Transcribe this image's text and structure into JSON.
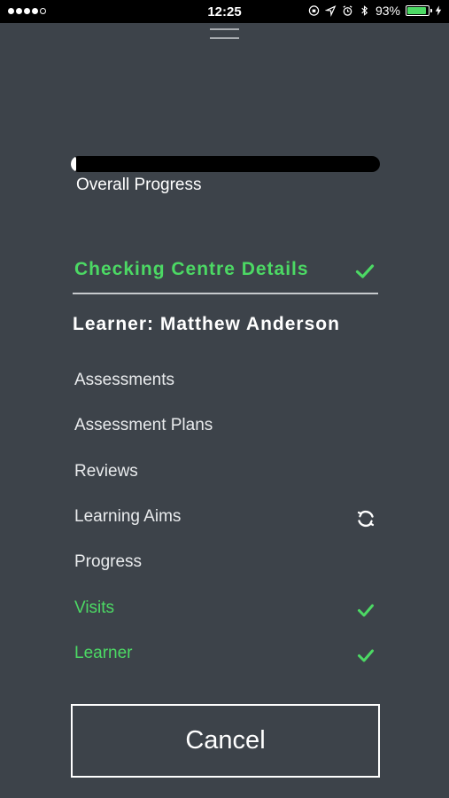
{
  "status_bar": {
    "time": "12:25",
    "battery_percent": "93%",
    "battery_level": 0.93,
    "signal_bars_filled": 4,
    "signal_bars_total": 5
  },
  "progress": {
    "label": "Overall Progress",
    "value": 0.01
  },
  "section": {
    "title": "Checking Centre Details",
    "status_icon": "check-icon"
  },
  "learner": {
    "title": "Learner: Matthew Anderson"
  },
  "items": [
    {
      "label": "Assessments",
      "status": "pending"
    },
    {
      "label": "Assessment Plans",
      "status": "pending"
    },
    {
      "label": "Reviews",
      "status": "pending"
    },
    {
      "label": "Learning Aims",
      "status": "loading"
    },
    {
      "label": "Progress",
      "status": "pending"
    },
    {
      "label": "Visits",
      "status": "done"
    },
    {
      "label": "Learner",
      "status": "done"
    }
  ],
  "cancel_label": "Cancel",
  "colors": {
    "background": "#3d434a",
    "accent_green": "#4cd964",
    "progress_track": "#000000",
    "text": "#ffffff"
  }
}
